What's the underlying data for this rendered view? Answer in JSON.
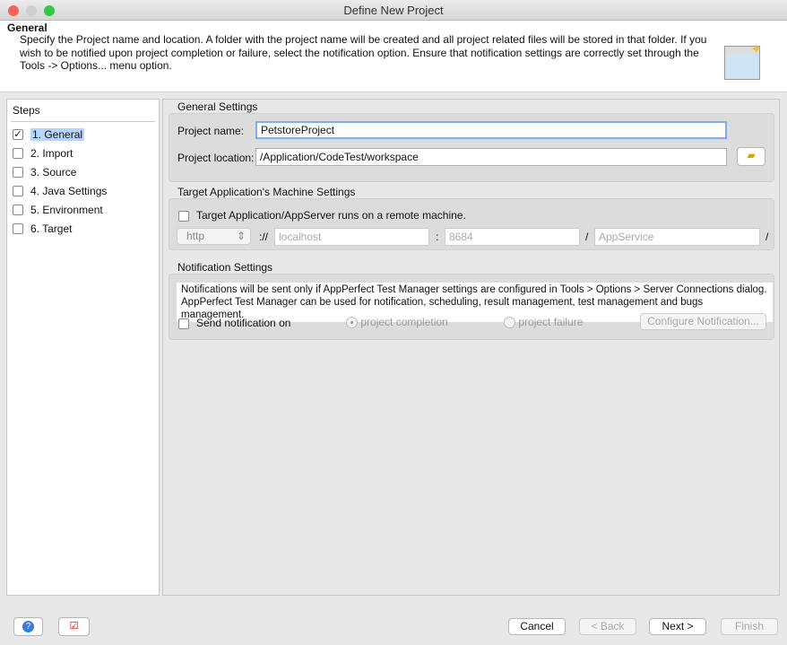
{
  "window": {
    "title": "Define New Project"
  },
  "header": {
    "title": "General",
    "description": "Specify the Project name and location. A folder with the project name will be created and all project related files will be stored in that folder. If you wish to be notified upon project completion or failure, select the notification option. Ensure that notification settings are correctly set through the Tools -> Options... menu option.",
    "icon": "wizard-window-icon"
  },
  "steps": {
    "title": "Steps",
    "items": [
      {
        "label": "1. General",
        "checked": true,
        "selected": true
      },
      {
        "label": "2. Import",
        "checked": false
      },
      {
        "label": "3. Source",
        "checked": false
      },
      {
        "label": "4. Java Settings",
        "checked": false
      },
      {
        "label": "5. Environment",
        "checked": false
      },
      {
        "label": "6. Target",
        "checked": false
      }
    ]
  },
  "general": {
    "title": "General Settings",
    "name_label": "Project name:",
    "name_value": "PetstoreProject",
    "location_label": "Project location:",
    "location_value": "/Application/CodeTest/workspace",
    "browse_icon": "folder-icon"
  },
  "target": {
    "title": "Target Application's Machine Settings",
    "remote_label": "Target Application/AppServer runs on a remote machine.",
    "protocol": "http",
    "sep1": "://",
    "host": "localhost",
    "sep2": ":",
    "port": "8684",
    "sep3": "/",
    "service": "AppService",
    "sep4": "/"
  },
  "notification": {
    "title": "Notification Settings",
    "info": "Notifications will be sent only if AppPerfect Test Manager settings are configured in Tools > Options > Server Connections dialog. AppPerfect Test Manager can be used for notification, scheduling, result management, test management and bugs management.",
    "send_label": "Send notification on",
    "opt_completion": "project completion",
    "opt_failure": "project failure",
    "configure_label": "Configure Notification..."
  },
  "footer": {
    "cancel": "Cancel",
    "back": "< Back",
    "next": "Next >",
    "finish": "Finish"
  }
}
